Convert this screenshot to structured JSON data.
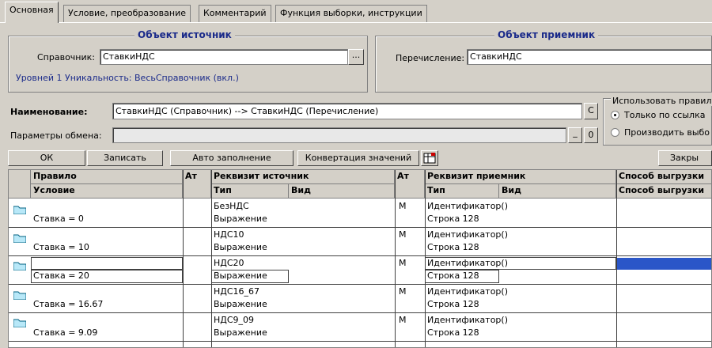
{
  "tabs": [
    {
      "label": "Основная"
    },
    {
      "label": "Условие, преобразование"
    },
    {
      "label": "Комментарий"
    },
    {
      "label": "Функция выборки, инструкции"
    }
  ],
  "source": {
    "title": "Объект источник",
    "ref_label": "Справочник:",
    "ref_value": "СтавкиНДС",
    "select_btn": "...",
    "info": "Уровней 1 Уникальность: ВесьСправочник (вкл.)"
  },
  "target": {
    "title": "Объект приемник",
    "enum_label": "Перечисление:",
    "enum_value": "СтавкиНДС"
  },
  "name_row": {
    "label": "Наименование:",
    "value": "СтавкиНДС (Справочник) --> СтавкиНДС (Перечисление)",
    "c_btn": "С"
  },
  "params_row": {
    "label": "Параметры обмена:",
    "value": "",
    "minus_btn": "_",
    "zero_btn": "0"
  },
  "right_options": {
    "title": "Использовать правил",
    "opt1": "Только по ссылка",
    "opt2": "Производить выбо"
  },
  "toolbar": {
    "ok": "ОК",
    "write": "Записать",
    "auto": "Авто заполнение",
    "convert": "Конвертация значений",
    "close": "Закры"
  },
  "grid": {
    "headers": {
      "rule": "Правило",
      "condition": "Условие",
      "at1": "Ат",
      "src_prop": "Реквизит источник",
      "src_type": "Тип",
      "src_kind": "Вид",
      "at2": "Ат",
      "dst_prop": "Реквизит приемник",
      "dst_type": "Тип",
      "dst_kind": "Вид",
      "method": "Способ выгрузки",
      "method2": "Способ выгрузки"
    },
    "rows": [
      {
        "condition": "Ставка = 0",
        "src_name": "БезНДС",
        "src_kind": "Выражение",
        "at2": "М",
        "dst_name": "Идентификатор()",
        "dst_type": "Строка 128"
      },
      {
        "condition": "Ставка = 10",
        "src_name": "НДС10",
        "src_kind": "Выражение",
        "at2": "М",
        "dst_name": "Идентификатор()",
        "dst_type": "Строка 128"
      },
      {
        "condition": "Ставка = 20",
        "src_name": "НДС20",
        "src_kind": "Выражение",
        "at2": "М",
        "dst_name": "Идентификатор()",
        "dst_type": "Строка 128"
      },
      {
        "condition": "Ставка = 16.67",
        "src_name": "НДС16_67",
        "src_kind": "Выражение",
        "at2": "М",
        "dst_name": "Идентификатор()",
        "dst_type": "Строка 128"
      },
      {
        "condition": "Ставка = 9.09",
        "src_name": "НДС9_09",
        "src_kind": "Выражение",
        "at2": "М",
        "dst_name": "Идентификатор()",
        "dst_type": "Строка 128"
      }
    ]
  },
  "colors": {
    "selection": "#2a56c8",
    "title_blue": "#1a2a8a"
  }
}
